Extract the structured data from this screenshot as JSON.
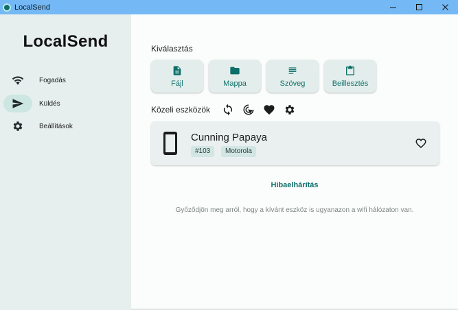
{
  "window": {
    "title": "LocalSend"
  },
  "sidebar": {
    "brand": "LocalSend",
    "items": [
      {
        "label": "Fogadás",
        "icon": "wifi-icon",
        "active": false
      },
      {
        "label": "Küldés",
        "icon": "send-icon",
        "active": true
      },
      {
        "label": "Beállítások",
        "icon": "gear-icon",
        "active": false
      }
    ]
  },
  "main": {
    "selection_title": "Kiválasztás",
    "choices": [
      {
        "label": "Fájl",
        "icon": "file-icon"
      },
      {
        "label": "Mappa",
        "icon": "folder-icon"
      },
      {
        "label": "Szöveg",
        "icon": "text-icon"
      },
      {
        "label": "Beillesztés",
        "icon": "clipboard-icon"
      }
    ],
    "nearby_title": "Közeli eszközök",
    "nearby_tools": [
      "refresh-icon",
      "scan-target-icon",
      "favorites-heart-icon",
      "settings-gear-icon"
    ],
    "devices": [
      {
        "name": "Cunning Papaya",
        "tags": [
          "#103",
          "Motorola"
        ],
        "icon": "smartphone-icon"
      }
    ],
    "troubleshoot": "Hibaelhárítás",
    "hint": "Győződjön meg arról, hogy a kívánt eszköz is ugyanazon a wifi hálózaton van."
  },
  "colors": {
    "accent": "#0e6f6a",
    "sidebar_bg": "#e7efee",
    "titlebar_bg": "#74b9f5",
    "card_bg": "#e9f0ef"
  }
}
